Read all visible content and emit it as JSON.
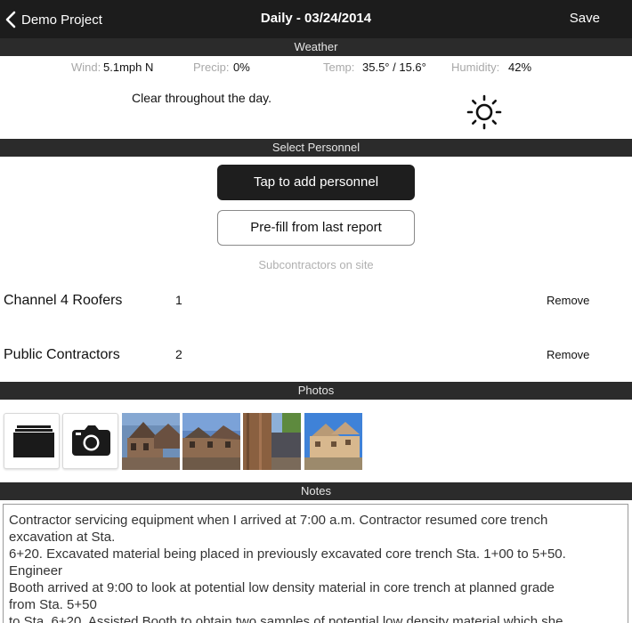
{
  "navbar": {
    "back_label": "Demo Project",
    "title": "Daily - 03/24/2014",
    "save_label": "Save"
  },
  "sections": {
    "weather": "Weather",
    "personnel": "Select Personnel",
    "photos": "Photos",
    "notes": "Notes"
  },
  "weather": {
    "wind_label": "Wind:",
    "wind_value": "5.1mph N",
    "precip_label": "Precip:",
    "precip_value": "0%",
    "temp_label": "Temp:",
    "temp_value": "35.5° / 15.6°",
    "humidity_label": "Humidity:",
    "humidity_value": "42%",
    "description": "Clear throughout the day.",
    "icon": "sun-icon"
  },
  "personnel": {
    "add_label": "Tap to add personnel",
    "prefill_label": "Pre-fill from last report",
    "subcontractors_caption": "Subcontractors on site",
    "subcontractors": [
      {
        "name": "Channel 4 Roofers",
        "count": "1",
        "remove_label": "Remove"
      },
      {
        "name": "Public Contractors",
        "count": "2",
        "remove_label": "Remove"
      }
    ]
  },
  "photos": {
    "actions": [
      "photo-library-icon",
      "camera-icon"
    ],
    "thumbnail_count": 4
  },
  "notes": {
    "lines": [
      "Contractor servicing equipment when I arrived at 7:00 a.m. Contractor resumed core trench",
      "excavation at Sta.",
      "6+20. Excavated material being placed in previously excavated core trench Sta. 1+00 to 5+50.",
      "Engineer",
      "Booth arrived at 9:00 to look at potential low density material in core trench at planned grade",
      "from Sta. 5+50",
      "to Sta. 6+20. Assisted Booth to obtain two samples of potential low density material which she"
    ]
  },
  "colors": {
    "navbar_bg": "#1c1c1c",
    "section_header_bg": "#2b2b2b",
    "primary_button_bg": "#1e1e1e",
    "muted_text": "#a8a8a8"
  }
}
